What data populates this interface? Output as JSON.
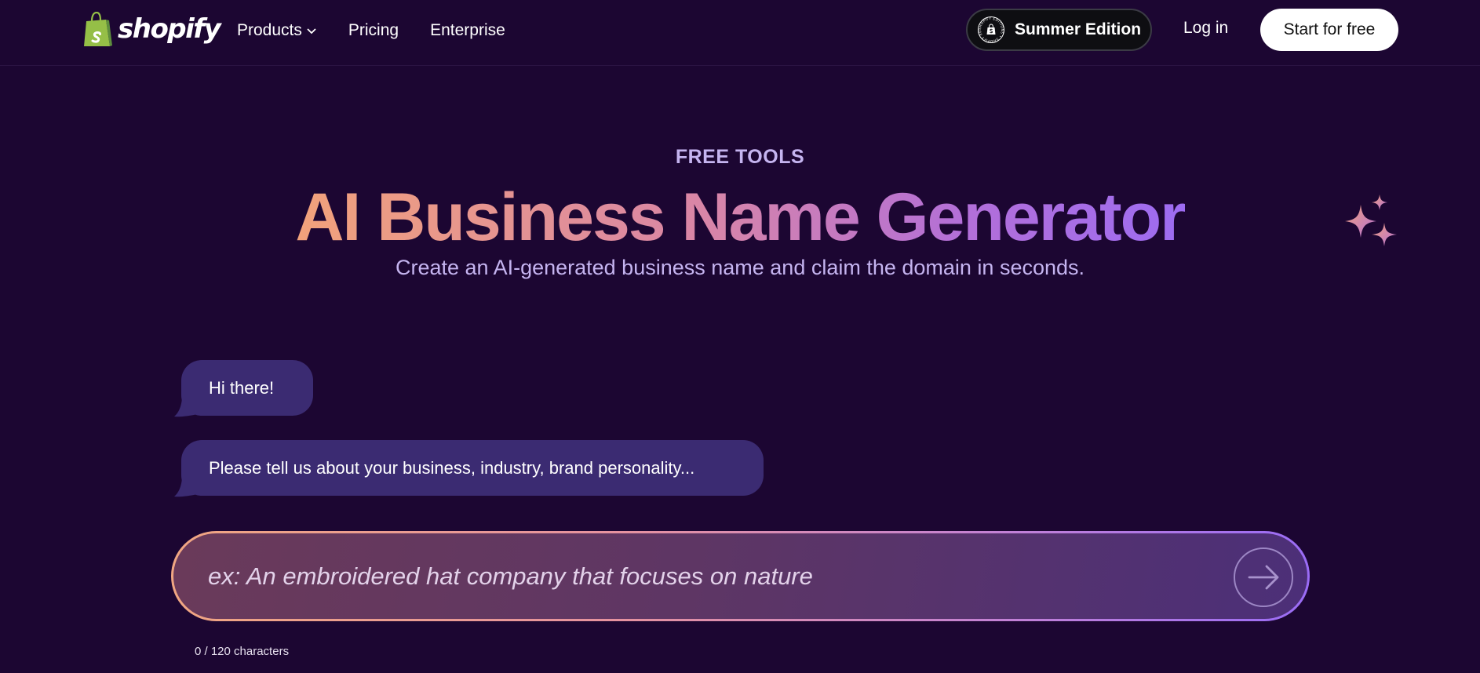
{
  "header": {
    "logo_text": "shopify",
    "nav": [
      {
        "label": "Products",
        "has_dropdown": true
      },
      {
        "label": "Pricing",
        "has_dropdown": false
      },
      {
        "label": "Enterprise",
        "has_dropdown": false
      }
    ],
    "edition_button": {
      "label": "Summer Edition",
      "badge_ring_text": "SHOPIFY EDITIONS • SHOPIFY EDITIONS •"
    },
    "login_label": "Log in",
    "cta_label": "Start for free"
  },
  "hero": {
    "eyebrow": "FREE TOOLS",
    "title": "AI Business Name Generator",
    "subtitle": "Create an AI-generated business name and claim the domain in seconds."
  },
  "chat": {
    "messages": [
      {
        "text": "Hi there!"
      },
      {
        "text": "Please tell us about your business, industry, brand personality..."
      }
    ],
    "input": {
      "value": "",
      "placeholder": "ex: An embroidered hat company that focuses on nature"
    },
    "char_count": "0 / 120 characters"
  },
  "colors": {
    "background": "#1c0632",
    "bubble": "#3b2b72",
    "accent_light": "#c5b4f0",
    "gradient_start": "#f2a27b",
    "gradient_end": "#9d6cf2",
    "logo_green": "#95bf47"
  },
  "icons": {
    "logo": "shopify-bag-icon",
    "dropdown": "chevron-down-icon",
    "badge": "shopify-editions-badge-icon",
    "decoration": "sparkles-icon",
    "send": "arrow-right-icon"
  }
}
